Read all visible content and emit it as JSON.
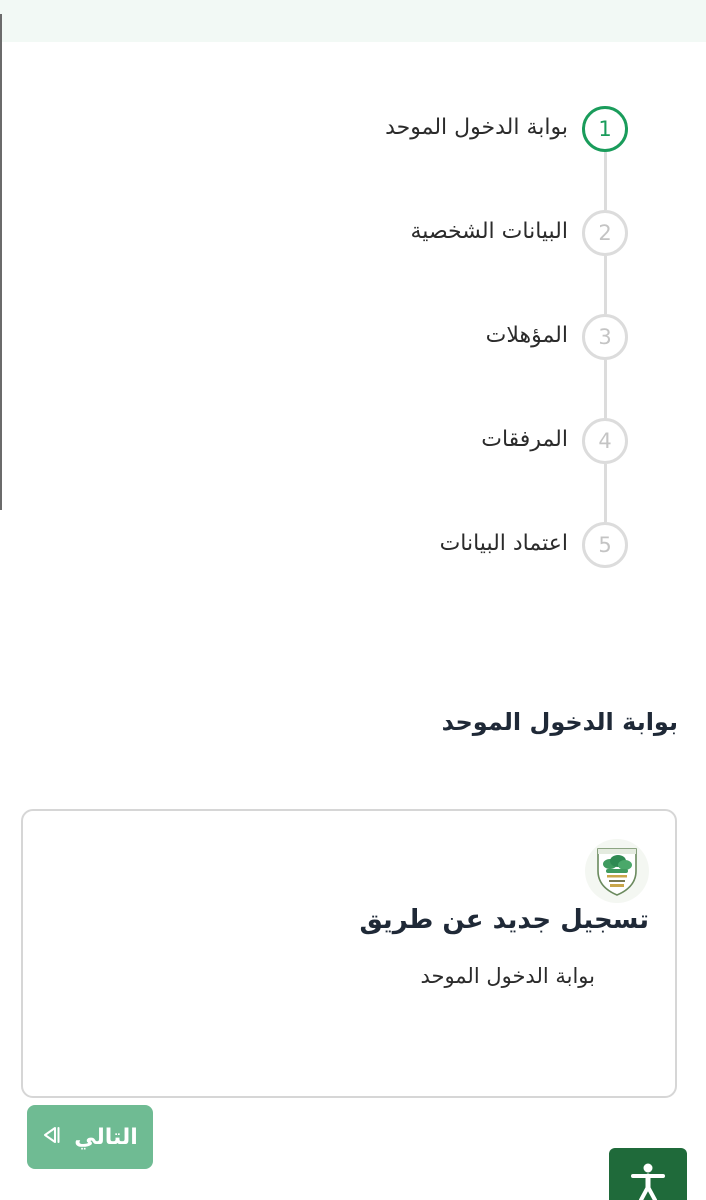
{
  "stepper": {
    "steps": [
      {
        "number": "1",
        "label": "بوابة الدخول الموحد"
      },
      {
        "number": "2",
        "label": "البيانات الشخصية"
      },
      {
        "number": "3",
        "label": "المؤهلات"
      },
      {
        "number": "4",
        "label": "المرفقات"
      },
      {
        "number": "5",
        "label": "اعتماد البيانات"
      }
    ],
    "active_index": 0
  },
  "section": {
    "title": "بوابة الدخول الموحد"
  },
  "card": {
    "logo_icon": "unified-login-logo-icon",
    "heading": "تسجيل جديد عن طريق",
    "subtext": "بوابة الدخول الموحد"
  },
  "actions": {
    "next_label": "التالي",
    "next_icon": "skip-next-icon",
    "accessibility_icon": "accessibility-icon"
  },
  "colors": {
    "accent": "#1a9c5b",
    "next_button": "#6fbb93",
    "accessibility_button": "#1f6a3a",
    "inactive_step": "#dcdcdc"
  }
}
